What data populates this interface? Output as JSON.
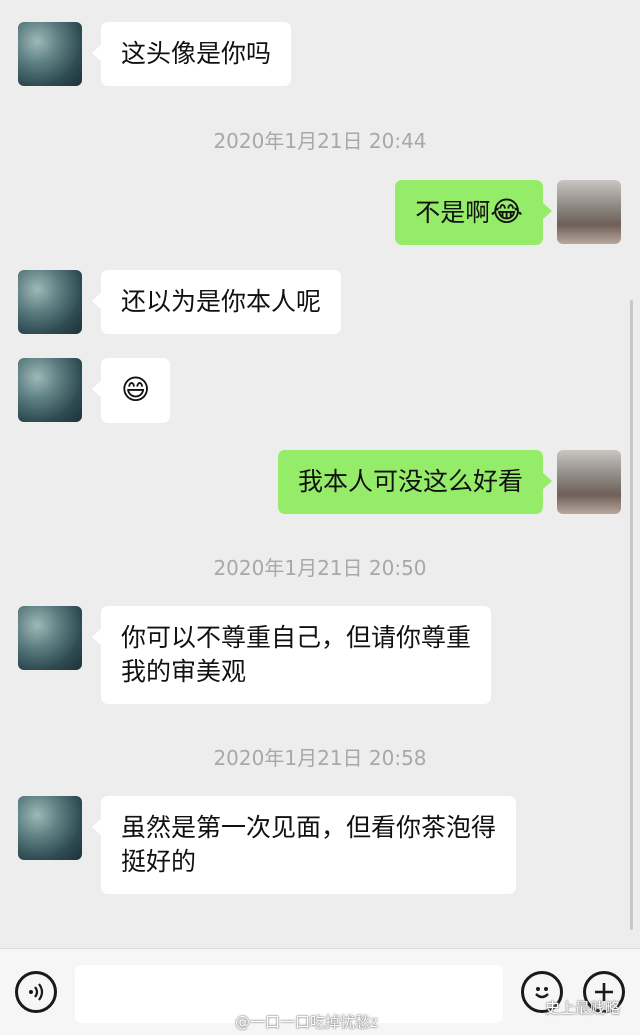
{
  "messages": [
    {
      "type": "received",
      "text": "这头像是你吗"
    },
    {
      "type": "timestamp",
      "text": "2020年1月21日 20:44"
    },
    {
      "type": "sent",
      "text": "不是啊",
      "emoji": "😂"
    },
    {
      "type": "received",
      "text": "还以为是你本人呢"
    },
    {
      "type": "received",
      "emoji": "😄"
    },
    {
      "type": "sent",
      "text": "我本人可没这么好看"
    },
    {
      "type": "timestamp",
      "text": "2020年1月21日 20:50"
    },
    {
      "type": "received",
      "line1": "你可以不尊重自己，但请你尊重",
      "line2": "我的审美观"
    },
    {
      "type": "timestamp",
      "text": "2020年1月21日 20:58"
    },
    {
      "type": "received",
      "line1": "虽然是第一次见面，但看你茶泡得",
      "line2": "挺好的"
    }
  ],
  "toolbar": {
    "voice_icon": "voice-icon",
    "emoji_icon": "emoji-face-icon",
    "plus_icon": "plus-icon",
    "input_value": ""
  },
  "watermarks": {
    "weibo": "@一口一口吃掉忧愁z",
    "wechat": "史上最贱略"
  },
  "colors": {
    "background": "#ededed",
    "sent_bubble": "#95ec69",
    "received_bubble": "#ffffff",
    "timestamp_text": "#a8a8a8"
  }
}
